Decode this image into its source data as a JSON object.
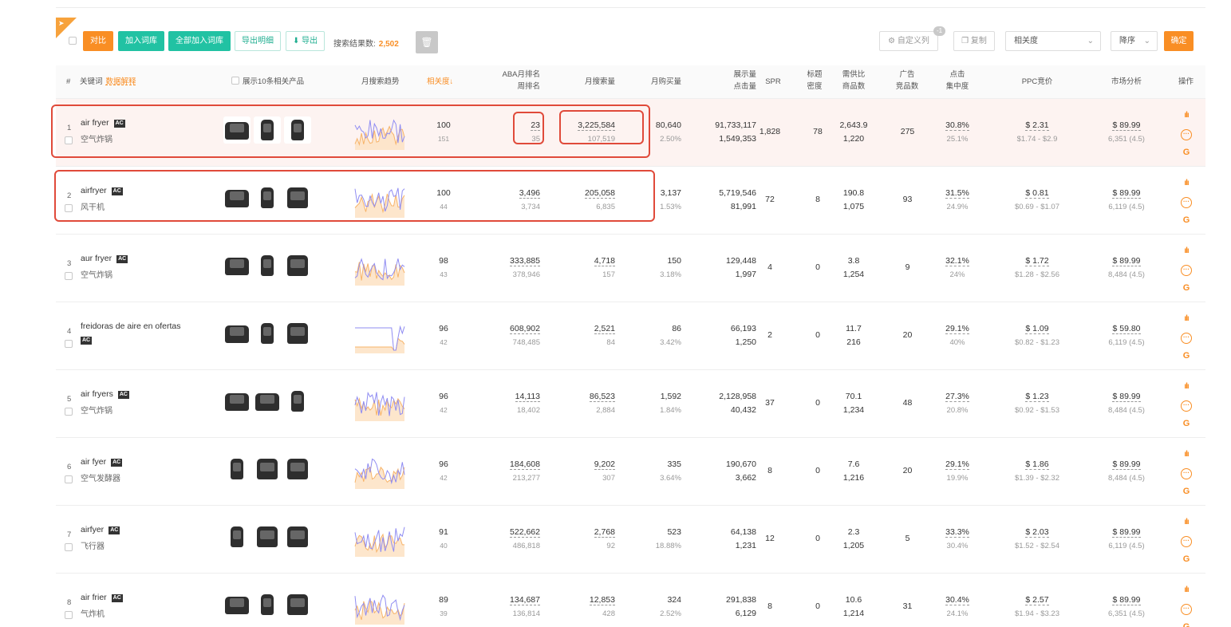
{
  "toolbar": {
    "compare_label": "对比",
    "add_lib_label": "加入词库",
    "add_all_label": "全部加入词库",
    "export_detail_label": "导出明细",
    "export_label": "导出",
    "result_count_label": "搜索结果数:",
    "result_count": "2,502",
    "custom_cols_label": "自定义列",
    "custom_cols_badge": "-1",
    "copy_label": "复制",
    "sort_field": "相关度",
    "sort_order": "降序",
    "confirm_label": "确定"
  },
  "columns": {
    "index": "#",
    "keyword": "关键词",
    "data_explain": "数据解释",
    "show_products": "展示10条相关产品",
    "monthly_trend": "月搜索趋势",
    "relevance": "相关度↓",
    "aba_rank_1": "ABA月排名",
    "aba_rank_2": "周排名",
    "monthly_search": "月搜索量",
    "monthly_purchase": "月购买量",
    "impressions_1": "展示量",
    "impressions_2": "点击量",
    "spr": "SPR",
    "title_density_1": "标题",
    "title_density_2": "密度",
    "supply_ratio_1": "需供比",
    "supply_ratio_2": "商品数",
    "ad_comp_1": "广告",
    "ad_comp_2": "竞品数",
    "click_conc_1": "点击",
    "click_conc_2": "集中度",
    "ppc": "PPC竞价",
    "market": "市场分析",
    "actions": "操作"
  },
  "rows": [
    {
      "idx": "1",
      "keyword": "air fryer",
      "ac": "AC",
      "translation": "空气炸锅",
      "relevance": "100",
      "rel_sub": "151",
      "aba_month": "23",
      "aba_week": "35",
      "search": "3,225,584",
      "search_sub": "107,519",
      "purchase": "80,640",
      "purchase_rate": "2.50%",
      "impr": "91,733,117",
      "clicks": "1,549,353",
      "spr": "1,828",
      "density": "78",
      "supply": "2,643.9",
      "products": "1,220",
      "ad_comp": "275",
      "click_conc": "30.8%",
      "click_conc_sub": "25.1%",
      "ppc": "$ 2.31",
      "ppc_range": "$1.74 - $2.9",
      "price": "$ 89.99",
      "price_sub": "6,351 (4.5)"
    },
    {
      "idx": "2",
      "keyword": "airfryer",
      "ac": "AC",
      "translation": "风干机",
      "relevance": "100",
      "rel_sub": "44",
      "aba_month": "3,496",
      "aba_week": "3,734",
      "search": "205,058",
      "search_sub": "6,835",
      "purchase": "3,137",
      "purchase_rate": "1.53%",
      "impr": "5,719,546",
      "clicks": "81,991",
      "spr": "72",
      "density": "8",
      "supply": "190.8",
      "products": "1,075",
      "ad_comp": "93",
      "click_conc": "31.5%",
      "click_conc_sub": "24.9%",
      "ppc": "$ 0.81",
      "ppc_range": "$0.69 - $1.07",
      "price": "$ 89.99",
      "price_sub": "6,119 (4.5)"
    },
    {
      "idx": "3",
      "keyword": "aur fryer",
      "ac": "AC",
      "translation": "空气炸锅",
      "relevance": "98",
      "rel_sub": "43",
      "aba_month": "333,885",
      "aba_week": "378,946",
      "search": "4,718",
      "search_sub": "157",
      "purchase": "150",
      "purchase_rate": "3.18%",
      "impr": "129,448",
      "clicks": "1,997",
      "spr": "4",
      "density": "0",
      "supply": "3.8",
      "products": "1,254",
      "ad_comp": "9",
      "click_conc": "32.1%",
      "click_conc_sub": "24%",
      "ppc": "$ 1.72",
      "ppc_range": "$1.28 - $2.56",
      "price": "$ 89.99",
      "price_sub": "8,484 (4.5)"
    },
    {
      "idx": "4",
      "keyword": "freidoras de aire en ofertas",
      "ac": "AC",
      "translation": "",
      "relevance": "96",
      "rel_sub": "42",
      "aba_month": "608,902",
      "aba_week": "748,485",
      "search": "2,521",
      "search_sub": "84",
      "purchase": "86",
      "purchase_rate": "3.42%",
      "impr": "66,193",
      "clicks": "1,250",
      "spr": "2",
      "density": "0",
      "supply": "11.7",
      "products": "216",
      "ad_comp": "20",
      "click_conc": "29.1%",
      "click_conc_sub": "40%",
      "ppc": "$ 1.09",
      "ppc_range": "$0.82 - $1.23",
      "price": "$ 59.80",
      "price_sub": "6,119 (4.5)"
    },
    {
      "idx": "5",
      "keyword": "air fryers",
      "ac": "AC",
      "translation": "空气炸锅",
      "relevance": "96",
      "rel_sub": "42",
      "aba_month": "14,113",
      "aba_week": "18,402",
      "search": "86,523",
      "search_sub": "2,884",
      "purchase": "1,592",
      "purchase_rate": "1.84%",
      "impr": "2,128,958",
      "clicks": "40,432",
      "spr": "37",
      "density": "0",
      "supply": "70.1",
      "products": "1,234",
      "ad_comp": "48",
      "click_conc": "27.3%",
      "click_conc_sub": "20.8%",
      "ppc": "$ 1.23",
      "ppc_range": "$0.92 - $1.53",
      "price": "$ 89.99",
      "price_sub": "8,484 (4.5)"
    },
    {
      "idx": "6",
      "keyword": "air fyer",
      "ac": "AC",
      "translation": "空气发酵器",
      "relevance": "96",
      "rel_sub": "42",
      "aba_month": "184,608",
      "aba_week": "213,277",
      "search": "9,202",
      "search_sub": "307",
      "purchase": "335",
      "purchase_rate": "3.64%",
      "impr": "190,670",
      "clicks": "3,662",
      "spr": "8",
      "density": "0",
      "supply": "7.6",
      "products": "1,216",
      "ad_comp": "20",
      "click_conc": "29.1%",
      "click_conc_sub": "19.9%",
      "ppc": "$ 1.86",
      "ppc_range": "$1.39 - $2.32",
      "price": "$ 89.99",
      "price_sub": "8,484 (4.5)"
    },
    {
      "idx": "7",
      "keyword": "airfyer",
      "ac": "AC",
      "translation": "飞行器",
      "relevance": "91",
      "rel_sub": "40",
      "aba_month": "522,662",
      "aba_week": "486,818",
      "search": "2,768",
      "search_sub": "92",
      "purchase": "523",
      "purchase_rate": "18.88%",
      "impr": "64,138",
      "clicks": "1,231",
      "spr": "12",
      "density": "0",
      "supply": "2.3",
      "products": "1,205",
      "ad_comp": "5",
      "click_conc": "33.3%",
      "click_conc_sub": "30.4%",
      "ppc": "$ 2.03",
      "ppc_range": "$1.52 - $2.54",
      "price": "$ 89.99",
      "price_sub": "6,119 (4.5)"
    },
    {
      "idx": "8",
      "keyword": "air frier",
      "ac": "AC",
      "translation": "气炸机",
      "relevance": "89",
      "rel_sub": "39",
      "aba_month": "134,687",
      "aba_week": "136,814",
      "search": "12,853",
      "search_sub": "428",
      "purchase": "324",
      "purchase_rate": "2.52%",
      "impr": "291,838",
      "clicks": "6,129",
      "spr": "8",
      "density": "0",
      "supply": "10.6",
      "products": "1,214",
      "ad_comp": "31",
      "click_conc": "30.4%",
      "click_conc_sub": "24.1%",
      "ppc": "$ 2.57",
      "ppc_range": "$1.94 - $3.23",
      "price": "$ 89.99",
      "price_sub": "6,351 (4.5)"
    }
  ],
  "colors": {
    "accent_orange": "#f98e24",
    "teal": "#21c2a3",
    "highlight_red": "#e04a3a",
    "spark_blue": "#8f8cf2",
    "spark_orange": "#f7b46a"
  }
}
